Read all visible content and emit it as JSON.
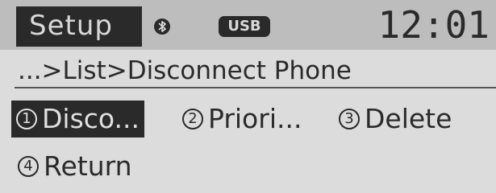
{
  "header": {
    "title": "Setup",
    "bluetooth_icon": "bluetooth-icon",
    "usb_label": "USB",
    "clock": "12:01"
  },
  "breadcrumb": "...>List>Disconnect Phone",
  "menu": {
    "items": [
      {
        "number": "1",
        "label": "Disco...",
        "selected": true
      },
      {
        "number": "2",
        "label": "Priori...",
        "selected": false
      },
      {
        "number": "3",
        "label": "Delete",
        "selected": false
      },
      {
        "number": "4",
        "label": "Return",
        "selected": false
      }
    ]
  },
  "colors": {
    "background": "#dcdcdc",
    "header_background": "#bdbdbd",
    "text_dark": "#2a2a2a",
    "text_light": "#d8d8d8"
  }
}
